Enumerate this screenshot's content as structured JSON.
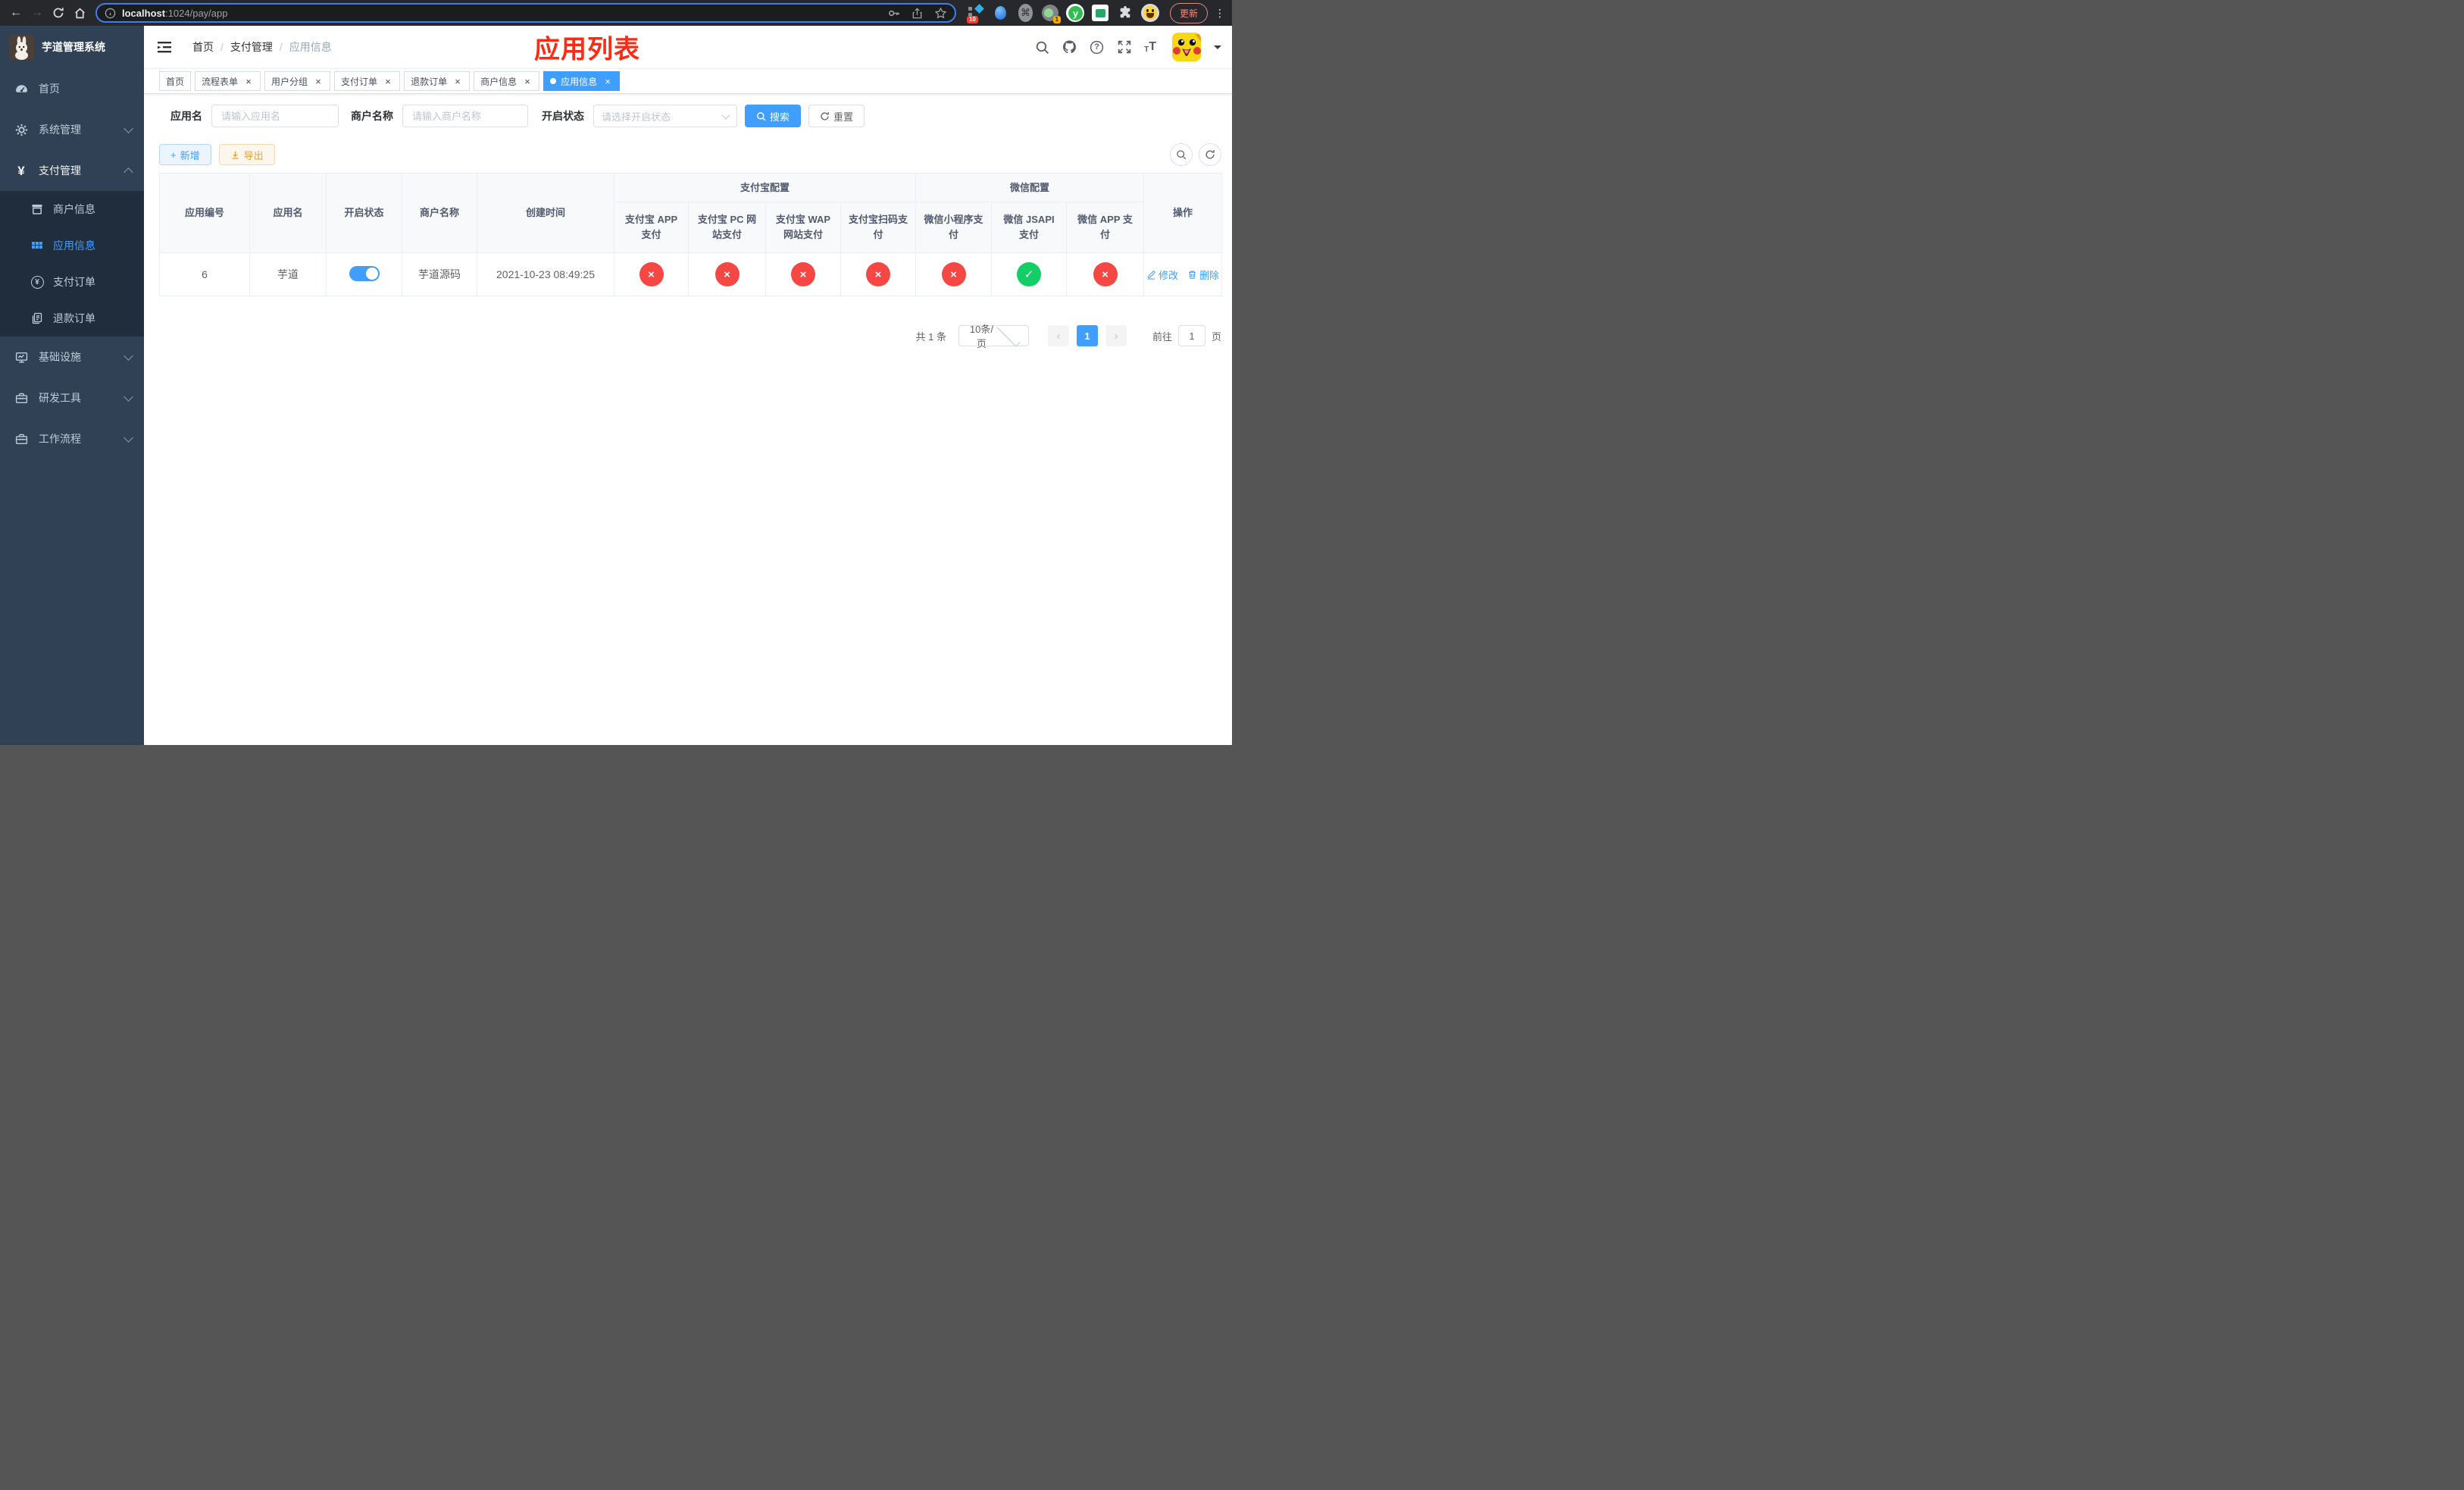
{
  "browser": {
    "url_host": "localhost",
    "url_rest": ":1024/pay/app",
    "update_label": "更新",
    "ext_badge_ten": "10",
    "ext_badge_one": "1",
    "ext_y_letter": "y",
    "command_glyph": "⌘",
    "menu_dots": "⋮"
  },
  "sidebar": {
    "title": "芋道管理系统",
    "menu": [
      {
        "label": "首页"
      },
      {
        "label": "系统管理"
      },
      {
        "label": "支付管理"
      },
      {
        "label": "基础设施"
      },
      {
        "label": "研发工具"
      },
      {
        "label": "工作流程"
      }
    ],
    "submenu": [
      {
        "label": "商户信息"
      },
      {
        "label": "应用信息"
      },
      {
        "label": "支付订单"
      },
      {
        "label": "退款订单"
      }
    ],
    "currency_glyph": "¥"
  },
  "navbar": {
    "breadcrumb": [
      "首页",
      "支付管理",
      "应用信息"
    ],
    "separator": "/",
    "annotation": "应用列表",
    "question_glyph": "?"
  },
  "tabs": [
    {
      "label": "首页",
      "closable": false,
      "active": false
    },
    {
      "label": "流程表单",
      "closable": true,
      "active": false
    },
    {
      "label": "用户分组",
      "closable": true,
      "active": false
    },
    {
      "label": "支付订单",
      "closable": true,
      "active": false
    },
    {
      "label": "退款订单",
      "closable": true,
      "active": false
    },
    {
      "label": "商户信息",
      "closable": true,
      "active": false
    },
    {
      "label": "应用信息",
      "closable": true,
      "active": true
    }
  ],
  "close_glyph": "×",
  "filters": {
    "app_name_label": "应用名",
    "app_name_placeholder": "请输入应用名",
    "merchant_label": "商户名称",
    "merchant_placeholder": "请输入商户名称",
    "status_label": "开启状态",
    "status_placeholder": "请选择开启状态",
    "search_label": "搜索",
    "reset_label": "重置"
  },
  "toolbar": {
    "add_label": "新增",
    "add_icon_glyph": "+",
    "export_label": "导出"
  },
  "table": {
    "columns": {
      "app_id": "应用编号",
      "app_name": "应用名",
      "status": "开启状态",
      "merchant": "商户名称",
      "create_time": "创建时间",
      "alipay_group": "支付宝配置",
      "wechat_group": "微信配置",
      "alipay_app": "支付宝 APP 支付",
      "alipay_pc": "支付宝 PC 网站支付",
      "alipay_wap": "支付宝 WAP 网站支付",
      "alipay_qr": "支付宝扫码支付",
      "wx_lite": "微信小程序支付",
      "wx_jsapi": "微信 JSAPI 支付",
      "wx_app": "微信 APP 支付",
      "actions": "操作"
    },
    "row": {
      "app_id": "6",
      "app_name": "芋道",
      "status_on": true,
      "merchant": "芋道源码",
      "create_time": "2021-10-23 08:49:25",
      "statuses": [
        {
          "name": "alipay_app",
          "enabled": false,
          "glyph": "×"
        },
        {
          "name": "alipay_pc",
          "enabled": false,
          "glyph": "×"
        },
        {
          "name": "alipay_wap",
          "enabled": false,
          "glyph": "×"
        },
        {
          "name": "alipay_qr",
          "enabled": false,
          "glyph": "×"
        },
        {
          "name": "wx_lite",
          "enabled": false,
          "glyph": "×"
        },
        {
          "name": "wx_jsapi",
          "enabled": true,
          "glyph": "✓"
        },
        {
          "name": "wx_app",
          "enabled": false,
          "glyph": "×"
        }
      ],
      "edit_label": "修改",
      "delete_label": "删除"
    }
  },
  "pagination": {
    "total_label": "共 1 条",
    "page_size": "10条/页",
    "prev_glyph": "‹",
    "next_glyph": "›",
    "current_page": "1",
    "goto_label": "前往",
    "goto_value": "1",
    "page_unit": "页"
  },
  "colors": {
    "primary": "#409eff",
    "sidebar_bg": "#304156",
    "submenu_bg": "#1f2d3d",
    "danger_circle": "#f54743",
    "success_circle": "#13ce66",
    "annotation_red": "#fd2a14",
    "warning": "#e6a23c"
  }
}
